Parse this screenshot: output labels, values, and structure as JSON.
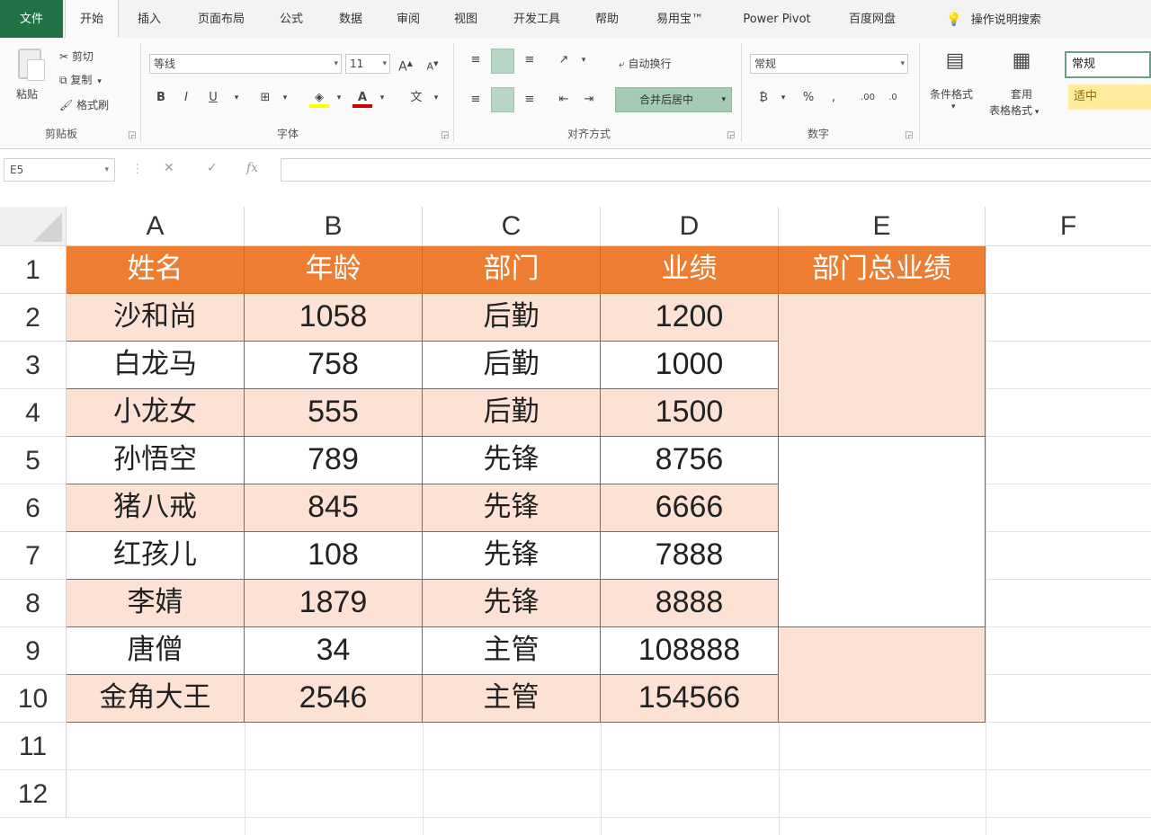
{
  "ribbon": {
    "tabs": [
      "文件",
      "开始",
      "插入",
      "页面布局",
      "公式",
      "数据",
      "审阅",
      "视图",
      "开发工具",
      "帮助",
      "易用宝™",
      "Power Pivot",
      "百度网盘",
      "操作说明搜索"
    ],
    "clipboard": {
      "paste": "粘贴",
      "cut": "剪切",
      "copy": "复制",
      "format_painter": "格式刷",
      "label": "剪贴板"
    },
    "font": {
      "name": "等线",
      "size": "11",
      "label": "字体",
      "grow": "A",
      "shrink": "A",
      "bold": "B",
      "italic": "I",
      "underline": "U"
    },
    "alignment": {
      "wrap_text": "自动换行",
      "merge_center": "合并后居中",
      "label": "对齐方式"
    },
    "number": {
      "format": "常规",
      "label": "数字",
      "percent": "%"
    },
    "styles": {
      "conditional": "条件格式",
      "table_format_1": "套用",
      "table_format_2": "表格格式",
      "style_normal": "常规",
      "style_neutral": "适中"
    }
  },
  "formula_bar": {
    "name_box": "E5",
    "cancel": "✕",
    "enter": "✓",
    "fx": "fx",
    "value": ""
  },
  "sheet": {
    "columns": [
      "A",
      "B",
      "C",
      "D",
      "E",
      "F"
    ],
    "rows": [
      "1",
      "2",
      "3",
      "4",
      "5",
      "6",
      "7",
      "8",
      "9",
      "10",
      "11",
      "12"
    ],
    "headers": [
      "姓名",
      "年龄",
      "部门",
      "业绩",
      "部门总业绩"
    ],
    "data": [
      [
        "沙和尚",
        "1058",
        "后勤",
        "1200"
      ],
      [
        "白龙马",
        "758",
        "后勤",
        "1000"
      ],
      [
        "小龙女",
        "555",
        "后勤",
        "1500"
      ],
      [
        "孙悟空",
        "789",
        "先锋",
        "8756"
      ],
      [
        "猪八戒",
        "845",
        "先锋",
        "6666"
      ],
      [
        "红孩儿",
        "108",
        "先锋",
        "7888"
      ],
      [
        "李婧",
        "1879",
        "先锋",
        "8888"
      ],
      [
        "唐僧",
        "34",
        "主管",
        "108888"
      ],
      [
        "金角大王",
        "2546",
        "主管",
        "154566"
      ]
    ]
  },
  "colors": {
    "header_fill": "#ed7d31",
    "band_fill": "#fbe2d5",
    "excel_green": "#217346"
  }
}
